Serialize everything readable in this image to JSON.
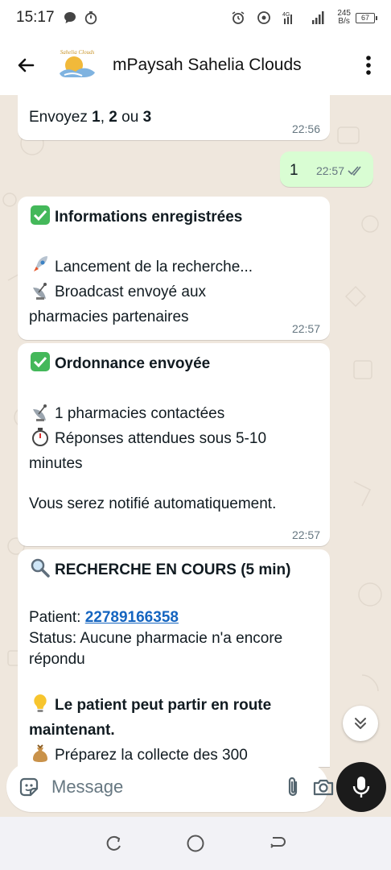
{
  "status_bar": {
    "time": "15:17",
    "network_speed_value": "245",
    "network_speed_unit": "B/s",
    "battery": "67",
    "network_type": "4G"
  },
  "header": {
    "contact_name": "mPaysah Sahelia Clouds",
    "avatar_text": "Sahelia Clouds"
  },
  "messages": [
    {
      "id": "m1",
      "direction": "in",
      "time": "22:56",
      "text_prefix": "Envoyez ",
      "opt1": "1",
      "sep1": ", ",
      "opt2": "2",
      "sep2": " ou ",
      "opt3": "3"
    },
    {
      "id": "m2",
      "direction": "out",
      "text": "1",
      "time": "22:57"
    },
    {
      "id": "m3",
      "direction": "in",
      "time": "22:57",
      "title": "Informations enregistrées",
      "line1": "Lancement de la recherche...",
      "line2a": "Broadcast envoyé aux",
      "line2b": "pharmacies partenaires"
    },
    {
      "id": "m4",
      "direction": "in",
      "time": "22:57",
      "title": "Ordonnance envoyée",
      "line1": "1 pharmacies contactées",
      "line2a": "Réponses attendues sous 5-10",
      "line2b": "minutes",
      "line3": "Vous serez notifié automatiquement."
    },
    {
      "id": "m5",
      "direction": "in",
      "title": "RECHERCHE EN COURS (5 min)",
      "patient_label": "Patient: ",
      "patient_phone": "22789166358",
      "status_a": "Status: Aucune pharmacie n'a encore",
      "status_b": "répondu",
      "hint_a": "Le patient peut partir en route",
      "hint_b": "maintenant.",
      "line_cut": "Préparez la collecte des 300"
    }
  ],
  "input": {
    "placeholder": "Message"
  },
  "icons": {
    "back": "arrow-left-icon",
    "menu": "more-vert-icon",
    "sticker": "sticker-icon",
    "attach": "paperclip-icon",
    "camera": "camera-icon",
    "mic": "microphone-icon",
    "scroll": "double-chevron-down-icon"
  },
  "colors": {
    "chat_background": "#efe7dd",
    "outgoing_bubble": "#d9fdd3",
    "incoming_bubble": "#ffffff",
    "link": "#1565c0",
    "mic_button": "#1b1b1b"
  }
}
